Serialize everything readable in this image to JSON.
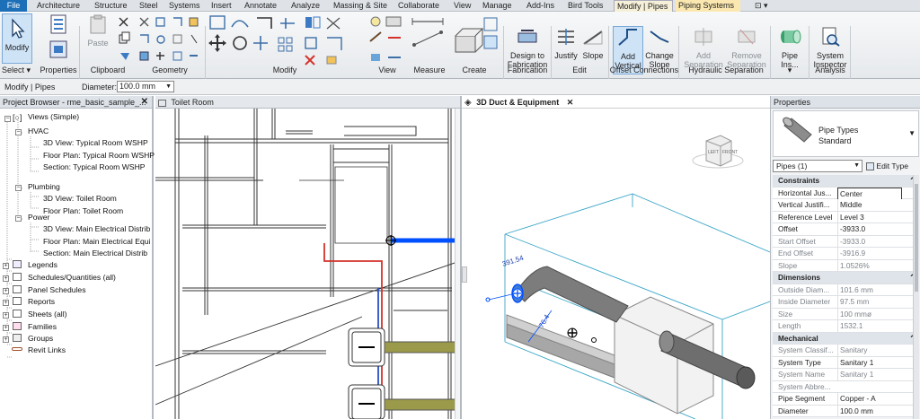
{
  "tabs": [
    "File",
    "Architecture",
    "Structure",
    "Steel",
    "Systems",
    "Insert",
    "Annotate",
    "Analyze",
    "Massing & Site",
    "Collaborate",
    "View",
    "Manage",
    "Add-Ins",
    "Bird Tools",
    "Modify | Pipes",
    "Piping Systems"
  ],
  "tab_dropdown_symbol": "⊡ ▾",
  "ribbon": {
    "modify_label": "Modify",
    "properties_label": "Properties",
    "paste_label": "Paste",
    "design_fabrication": "Design to\nFabrication",
    "justify": "Justify",
    "slope": "Slope",
    "add_vertical": "Add\nVertical",
    "change_slope": "Change\nSlope",
    "add_separation": "Add\nSeparation",
    "remove_separation": "Remove\nSeparation",
    "pipe_insulation": "Pipe Ins...",
    "system_inspector": "System\nInspector",
    "panels": [
      "Select ▾",
      "Properties",
      "Clipboard",
      "Geometry",
      "Modify",
      "View",
      "Measure",
      "Create",
      "Fabrication",
      "Edit",
      "Offset Connections",
      "Hydraulic Separation",
      "▾",
      "Analysis"
    ]
  },
  "optbar": {
    "context": "Modify | Pipes",
    "diameter_label": "Diameter:",
    "diameter_value": "100.0 mm"
  },
  "browser": {
    "title": "Project Browser - rme_basic_sample_...",
    "items": [
      "Views (Simple)",
      "HVAC",
      "3D View: Typical Room WSHP",
      "Floor Plan: Typical Room WSHP",
      "Section: Typical Room WSHP",
      "Plumbing",
      "3D View: Toilet Room",
      "Floor Plan: Toilet Room",
      "Power",
      "3D View: Main Electrical Distrib",
      "Floor Plan: Main Electrical Equi",
      "Section: Main Electrical Distrib",
      "Legends",
      "Schedules/Quantities (all)",
      "Panel Schedules",
      "Reports",
      "Sheets (all)",
      "Families",
      "Groups",
      "Revit Links"
    ]
  },
  "view1": {
    "title": "Toilet Room"
  },
  "view2": {
    "title": "3D Duct & Equipment",
    "dim1": "391.54",
    "dim2": "76.4",
    "viewcube_left": "LEFT",
    "viewcube_front": "FRONT"
  },
  "properties": {
    "title": "Properties",
    "type_family": "Pipe Types",
    "type_name": "Standard",
    "selector": "Pipes (1)",
    "edit_type": "Edit Type",
    "rows": [
      {
        "k": "Constraints",
        "v": "",
        "section": true
      },
      {
        "k": "Horizontal Jus...",
        "v": "Center"
      },
      {
        "k": "Vertical Justifi...",
        "v": "Middle"
      },
      {
        "k": "Reference Level",
        "v": "Level 3"
      },
      {
        "k": "Offset",
        "v": "-3933.0"
      },
      {
        "k": "Start Offset",
        "v": "-3933.0",
        "dim": true
      },
      {
        "k": "End Offset",
        "v": "-3916.9",
        "dim": true
      },
      {
        "k": "Slope",
        "v": "1.0526%",
        "dim": true
      },
      {
        "k": "Dimensions",
        "v": "",
        "section": true
      },
      {
        "k": "Outside Diam...",
        "v": "101.6 mm",
        "dim": true
      },
      {
        "k": "Inside Diameter",
        "v": "97.5 mm",
        "dim": true
      },
      {
        "k": "Size",
        "v": "100 mmø",
        "dim": true
      },
      {
        "k": "Length",
        "v": "1532.1",
        "dim": true
      },
      {
        "k": "Mechanical",
        "v": "",
        "section": true
      },
      {
        "k": "System Classif...",
        "v": "Sanitary",
        "dim": true
      },
      {
        "k": "System Type",
        "v": "Sanitary 1"
      },
      {
        "k": "System Name",
        "v": "Sanitary 1",
        "dim": true
      },
      {
        "k": "System Abbre...",
        "v": "",
        "dim": true
      },
      {
        "k": "Pipe Segment",
        "v": "Copper - A"
      },
      {
        "k": "Diameter",
        "v": "100.0 mm"
      }
    ]
  },
  "colors": {
    "accent": "#1d6fb8",
    "selection": "#0050ff",
    "pipe": "#9a9a4a",
    "redline": "#d4322b"
  }
}
